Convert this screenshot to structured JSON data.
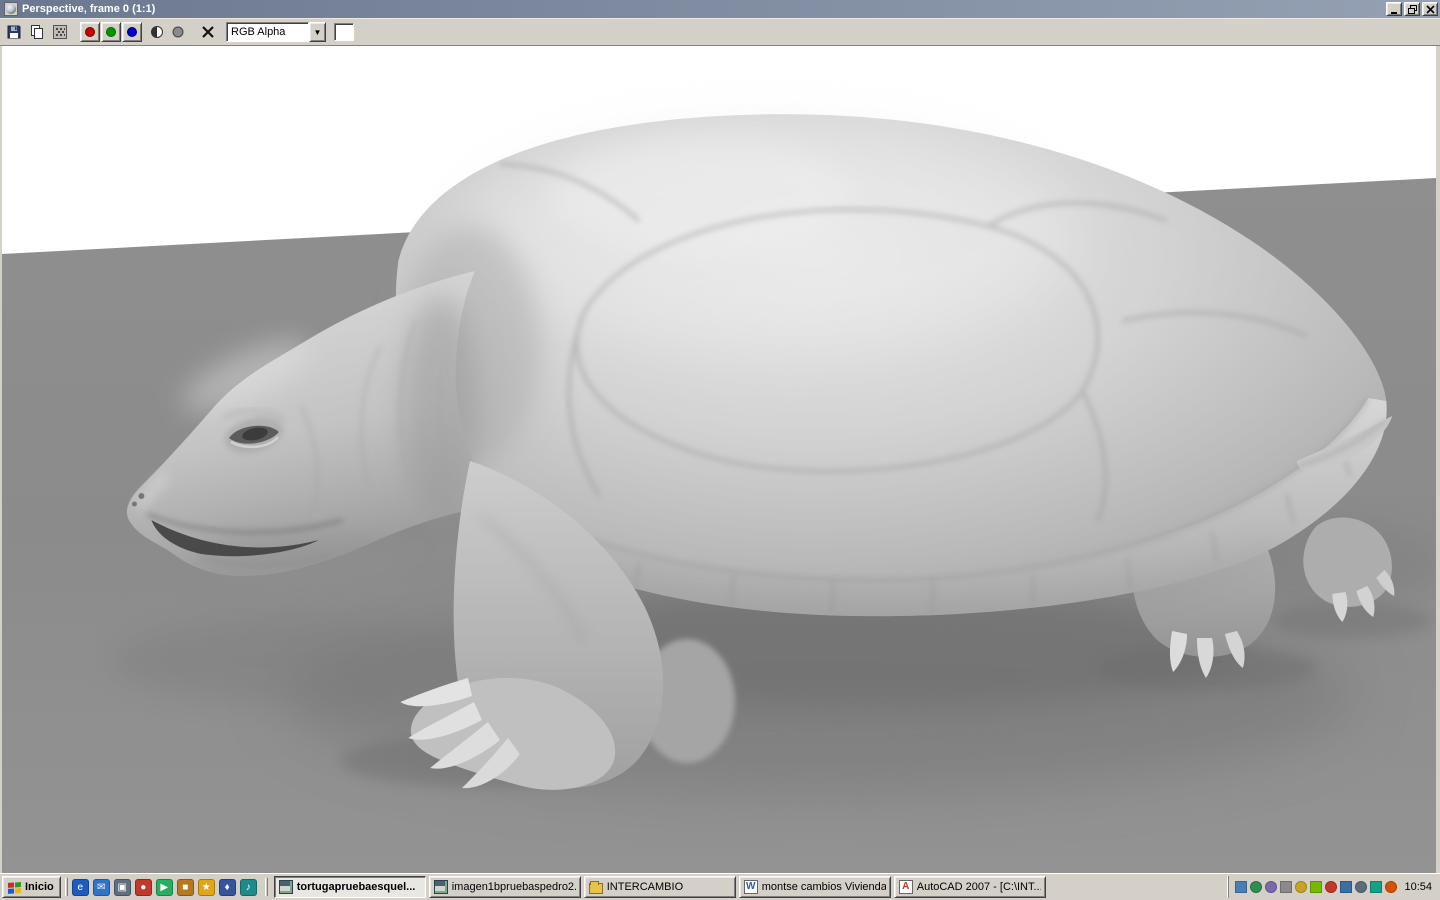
{
  "window": {
    "title": "Perspective, frame 0 (1:1)"
  },
  "toolbar": {
    "channel_dropdown_value": "RGB Alpha",
    "dropdown_arrow": "▼"
  },
  "scene": {
    "type": "3d-render",
    "subject": "turtle clay model on ground plane",
    "background_color": "#ffffff",
    "ground_color": "#8d8d8d",
    "model_color": "#c8c8c8"
  },
  "taskbar": {
    "start_label": "Inicio",
    "quick_launch": [
      {
        "name": "internet-explorer-icon",
        "glyph": "e",
        "color": "#1d5bbf"
      },
      {
        "name": "outlook-express-icon",
        "glyph": "✉",
        "color": "#2e74c9"
      },
      {
        "name": "show-desktop-icon",
        "glyph": "▣",
        "color": "#5f6f7f"
      },
      {
        "name": "media-player-icon",
        "glyph": "●",
        "color": "#c0392b"
      },
      {
        "name": "messenger-icon",
        "glyph": "▶",
        "color": "#27ae60"
      },
      {
        "name": "explorer-icon",
        "glyph": "■",
        "color": "#b7791f"
      },
      {
        "name": "winamp-icon",
        "glyph": "★",
        "color": "#e1a517"
      },
      {
        "name": "mail-icon",
        "glyph": "♦",
        "color": "#34559e"
      },
      {
        "name": "music-icon",
        "glyph": "♪",
        "color": "#1f8a8a"
      }
    ],
    "tasks": [
      {
        "label": "tortugapruebaesquel...",
        "active": true
      },
      {
        "label": "imagen1bpruebaspedro2...",
        "active": false
      },
      {
        "label": "INTERCAMBIO",
        "active": false
      },
      {
        "label": "montse cambios Vivienda...",
        "active": false,
        "icon_letter": "W"
      },
      {
        "label": "AutoCAD 2007 - [C:\\INT...",
        "active": false,
        "icon_letter": "A"
      }
    ],
    "tray_icons": [
      {
        "name": "display-settings-icon",
        "color": "#4a7fb5"
      },
      {
        "name": "antivirus-icon",
        "color": "#2f8f4e"
      },
      {
        "name": "messenger-tray-icon",
        "color": "#7b68ae"
      },
      {
        "name": "printer-icon",
        "color": "#8a8a8a"
      },
      {
        "name": "update-icon",
        "color": "#c9a227"
      },
      {
        "name": "graphics-driver-icon",
        "color": "#76b900"
      },
      {
        "name": "firewall-icon",
        "color": "#c0392b"
      },
      {
        "name": "network-icon",
        "color": "#3a6ea5"
      },
      {
        "name": "volume-icon",
        "color": "#5d6d7e"
      },
      {
        "name": "scanner-icon",
        "color": "#16a085"
      },
      {
        "name": "battery-icon",
        "color": "#d35400"
      }
    ],
    "clock": "10:54"
  }
}
